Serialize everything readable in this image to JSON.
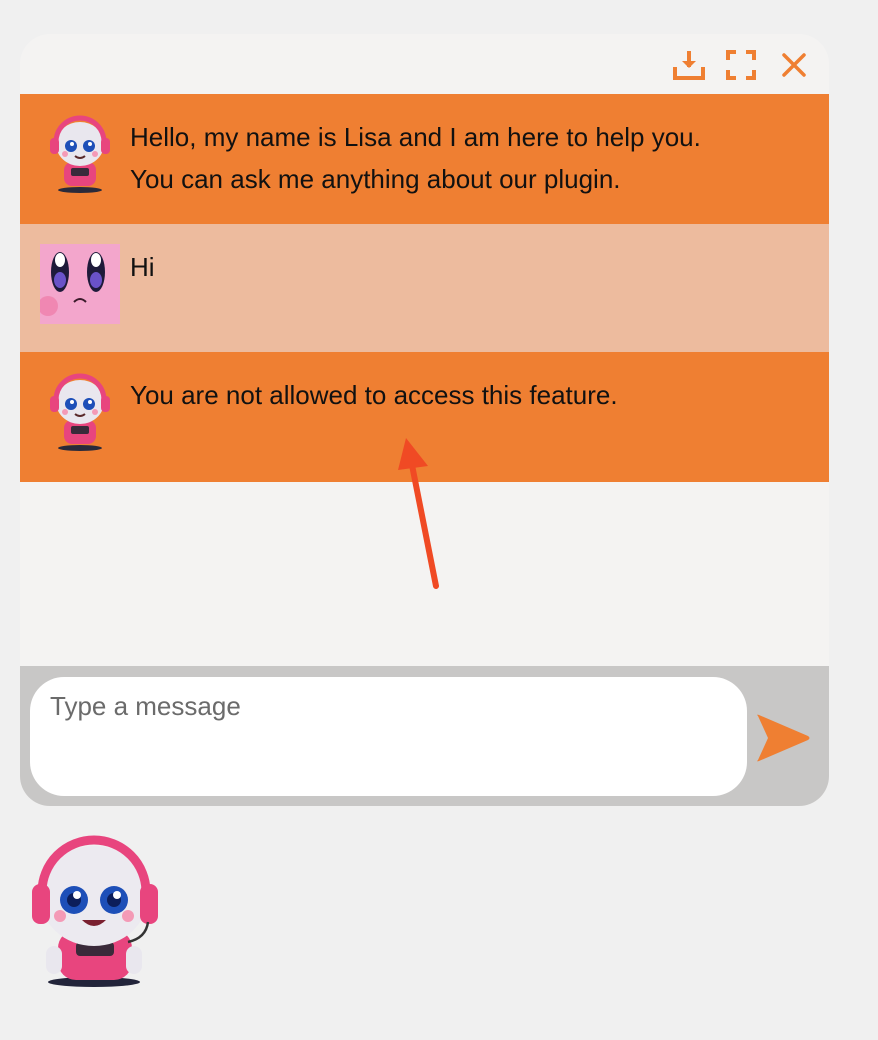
{
  "header": {
    "download_icon": "download-icon",
    "fullscreen_icon": "fullscreen-icon",
    "close_icon": "close-icon"
  },
  "messages": [
    {
      "sender": "bot",
      "text_line1": "Hello, my name is Lisa and I am here to help you.",
      "text_line2": "You can ask me anything about our plugin."
    },
    {
      "sender": "user",
      "text": "Hi"
    },
    {
      "sender": "bot",
      "text": "You are not allowed to access this feature."
    }
  ],
  "input": {
    "placeholder": "Type a message"
  },
  "colors": {
    "accent": "#ef7f32",
    "bot_bubble": "#ef7f32",
    "user_bubble": "#edbb9e",
    "input_bar": "#c8c7c6",
    "annotation_arrow": "#f04a24"
  }
}
